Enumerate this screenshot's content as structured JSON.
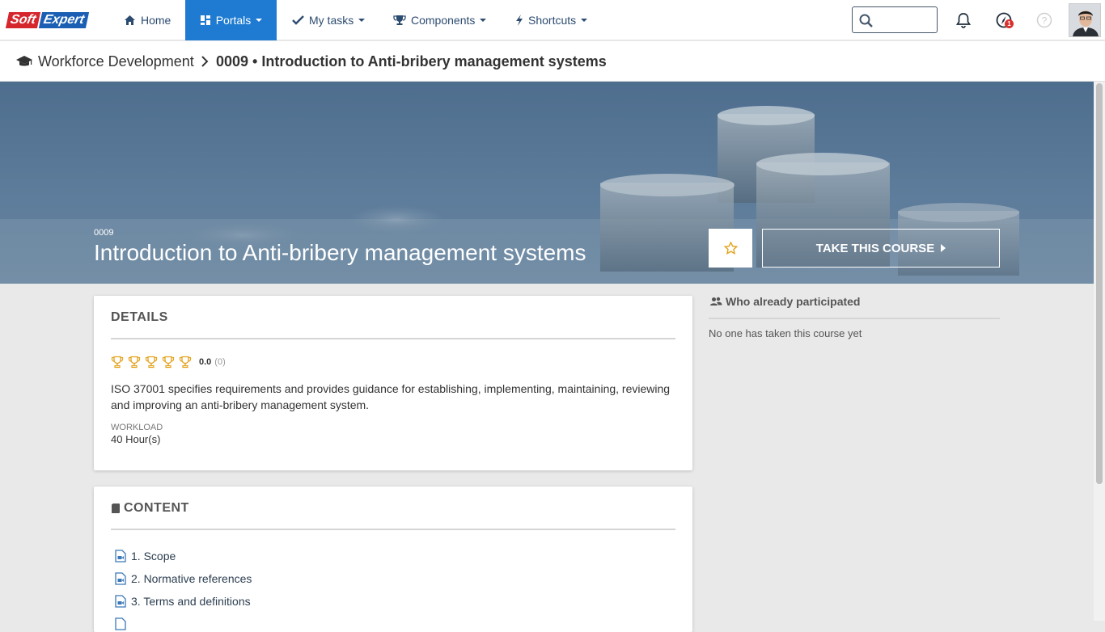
{
  "header": {
    "logo_left": "Soft",
    "logo_right": "Expert",
    "nav": {
      "home": "Home",
      "portals": "Portals",
      "my_tasks": "My tasks",
      "components": "Components",
      "shortcuts": "Shortcuts"
    },
    "search": {
      "placeholder": "",
      "value": ""
    },
    "notifications_badge": "1",
    "colors": {
      "active_nav": "#1e7bd1",
      "accent_link": "#2c4b70",
      "badge": "#d9302c"
    }
  },
  "breadcrumb": {
    "parent": "Workforce Development",
    "current": "0009 • Introduction to Anti-bribery management systems"
  },
  "course": {
    "code": "0009",
    "title": "Introduction to Anti-bribery management systems",
    "take_button": "TAKE THIS COURSE"
  },
  "details": {
    "heading": "DETAILS",
    "rating": "0.0",
    "rating_count": "(0)",
    "description": "ISO 37001 specifies requirements and provides guidance for establishing, implementing, maintaining, reviewing and improving an anti-bribery management system.",
    "workload_label": "WORKLOAD",
    "workload_value": "40 Hour(s)"
  },
  "content": {
    "heading": "CONTENT",
    "items": [
      {
        "label": "1. Scope"
      },
      {
        "label": "2. Normative references"
      },
      {
        "label": "3. Terms and definitions"
      }
    ]
  },
  "participants": {
    "heading": "Who already participated",
    "empty_text": "No one has taken this course yet"
  }
}
